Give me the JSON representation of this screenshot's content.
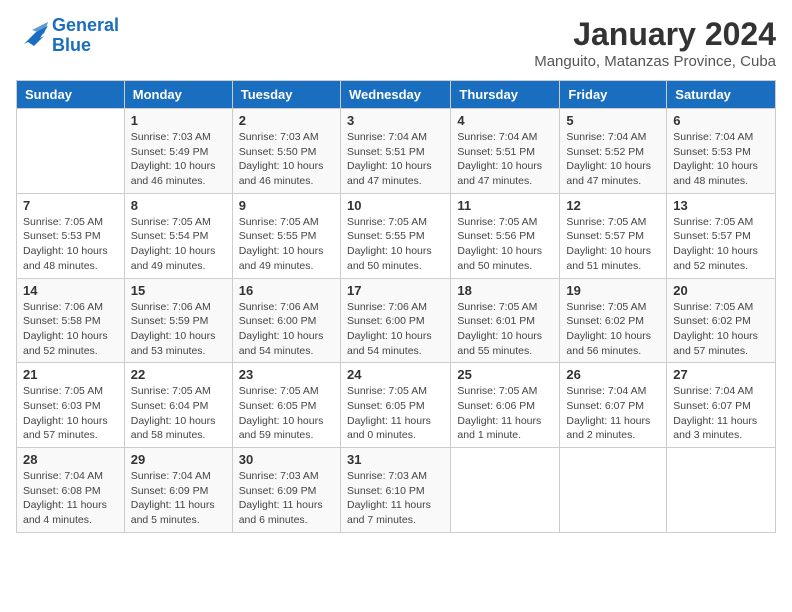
{
  "logo": {
    "line1": "General",
    "line2": "Blue"
  },
  "title": "January 2024",
  "subtitle": "Manguito, Matanzas Province, Cuba",
  "days_of_week": [
    "Sunday",
    "Monday",
    "Tuesday",
    "Wednesday",
    "Thursday",
    "Friday",
    "Saturday"
  ],
  "weeks": [
    [
      {
        "day": "",
        "info": ""
      },
      {
        "day": "1",
        "info": "Sunrise: 7:03 AM\nSunset: 5:49 PM\nDaylight: 10 hours and 46 minutes."
      },
      {
        "day": "2",
        "info": "Sunrise: 7:03 AM\nSunset: 5:50 PM\nDaylight: 10 hours and 46 minutes."
      },
      {
        "day": "3",
        "info": "Sunrise: 7:04 AM\nSunset: 5:51 PM\nDaylight: 10 hours and 47 minutes."
      },
      {
        "day": "4",
        "info": "Sunrise: 7:04 AM\nSunset: 5:51 PM\nDaylight: 10 hours and 47 minutes."
      },
      {
        "day": "5",
        "info": "Sunrise: 7:04 AM\nSunset: 5:52 PM\nDaylight: 10 hours and 47 minutes."
      },
      {
        "day": "6",
        "info": "Sunrise: 7:04 AM\nSunset: 5:53 PM\nDaylight: 10 hours and 48 minutes."
      }
    ],
    [
      {
        "day": "7",
        "info": "Sunrise: 7:05 AM\nSunset: 5:53 PM\nDaylight: 10 hours and 48 minutes."
      },
      {
        "day": "8",
        "info": "Sunrise: 7:05 AM\nSunset: 5:54 PM\nDaylight: 10 hours and 49 minutes."
      },
      {
        "day": "9",
        "info": "Sunrise: 7:05 AM\nSunset: 5:55 PM\nDaylight: 10 hours and 49 minutes."
      },
      {
        "day": "10",
        "info": "Sunrise: 7:05 AM\nSunset: 5:55 PM\nDaylight: 10 hours and 50 minutes."
      },
      {
        "day": "11",
        "info": "Sunrise: 7:05 AM\nSunset: 5:56 PM\nDaylight: 10 hours and 50 minutes."
      },
      {
        "day": "12",
        "info": "Sunrise: 7:05 AM\nSunset: 5:57 PM\nDaylight: 10 hours and 51 minutes."
      },
      {
        "day": "13",
        "info": "Sunrise: 7:05 AM\nSunset: 5:57 PM\nDaylight: 10 hours and 52 minutes."
      }
    ],
    [
      {
        "day": "14",
        "info": "Sunrise: 7:06 AM\nSunset: 5:58 PM\nDaylight: 10 hours and 52 minutes."
      },
      {
        "day": "15",
        "info": "Sunrise: 7:06 AM\nSunset: 5:59 PM\nDaylight: 10 hours and 53 minutes."
      },
      {
        "day": "16",
        "info": "Sunrise: 7:06 AM\nSunset: 6:00 PM\nDaylight: 10 hours and 54 minutes."
      },
      {
        "day": "17",
        "info": "Sunrise: 7:06 AM\nSunset: 6:00 PM\nDaylight: 10 hours and 54 minutes."
      },
      {
        "day": "18",
        "info": "Sunrise: 7:05 AM\nSunset: 6:01 PM\nDaylight: 10 hours and 55 minutes."
      },
      {
        "day": "19",
        "info": "Sunrise: 7:05 AM\nSunset: 6:02 PM\nDaylight: 10 hours and 56 minutes."
      },
      {
        "day": "20",
        "info": "Sunrise: 7:05 AM\nSunset: 6:02 PM\nDaylight: 10 hours and 57 minutes."
      }
    ],
    [
      {
        "day": "21",
        "info": "Sunrise: 7:05 AM\nSunset: 6:03 PM\nDaylight: 10 hours and 57 minutes."
      },
      {
        "day": "22",
        "info": "Sunrise: 7:05 AM\nSunset: 6:04 PM\nDaylight: 10 hours and 58 minutes."
      },
      {
        "day": "23",
        "info": "Sunrise: 7:05 AM\nSunset: 6:05 PM\nDaylight: 10 hours and 59 minutes."
      },
      {
        "day": "24",
        "info": "Sunrise: 7:05 AM\nSunset: 6:05 PM\nDaylight: 11 hours and 0 minutes."
      },
      {
        "day": "25",
        "info": "Sunrise: 7:05 AM\nSunset: 6:06 PM\nDaylight: 11 hours and 1 minute."
      },
      {
        "day": "26",
        "info": "Sunrise: 7:04 AM\nSunset: 6:07 PM\nDaylight: 11 hours and 2 minutes."
      },
      {
        "day": "27",
        "info": "Sunrise: 7:04 AM\nSunset: 6:07 PM\nDaylight: 11 hours and 3 minutes."
      }
    ],
    [
      {
        "day": "28",
        "info": "Sunrise: 7:04 AM\nSunset: 6:08 PM\nDaylight: 11 hours and 4 minutes."
      },
      {
        "day": "29",
        "info": "Sunrise: 7:04 AM\nSunset: 6:09 PM\nDaylight: 11 hours and 5 minutes."
      },
      {
        "day": "30",
        "info": "Sunrise: 7:03 AM\nSunset: 6:09 PM\nDaylight: 11 hours and 6 minutes."
      },
      {
        "day": "31",
        "info": "Sunrise: 7:03 AM\nSunset: 6:10 PM\nDaylight: 11 hours and 7 minutes."
      },
      {
        "day": "",
        "info": ""
      },
      {
        "day": "",
        "info": ""
      },
      {
        "day": "",
        "info": ""
      }
    ]
  ]
}
